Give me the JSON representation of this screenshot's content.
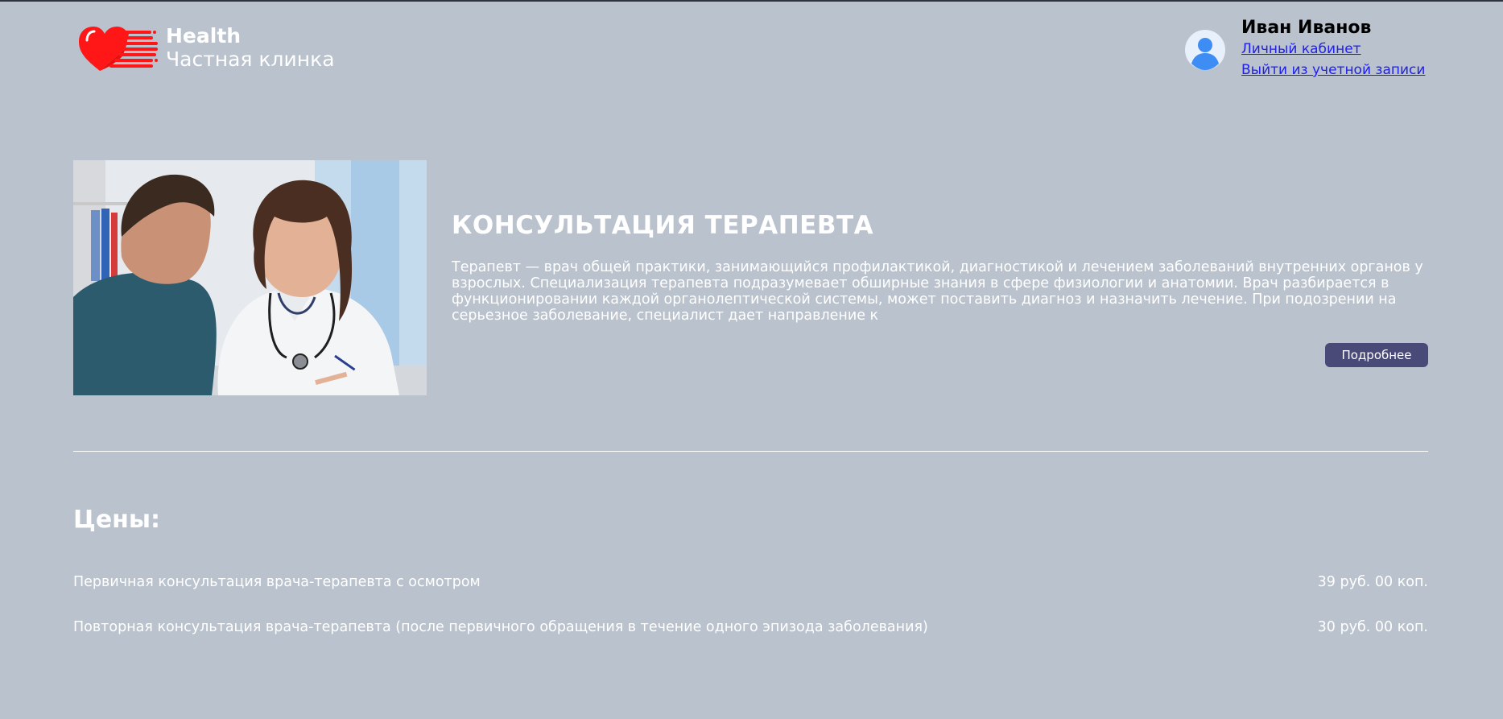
{
  "header": {
    "logo": {
      "title": "Health",
      "subtitle": "Частная клинка",
      "icon": "heart-speed-icon",
      "color": "#ff1a1a"
    },
    "user": {
      "name": "Иван Иванов",
      "profile_link": "Личный кабинет",
      "logout_link": "Выйти из учетной записи",
      "avatar_icon": "user-avatar-icon"
    }
  },
  "service": {
    "title": "КОНСУЛЬТАЦИЯ ТЕРАПЕВТА",
    "description": "Терапевт — врач общей практики, занимающийся профилактикой, диагностикой и лечением заболеваний внутренних органов у взрослых. Специализация терапевта подразумевает обширные знания в сфере физиологии и анатомии. Врач разбирается в функционировании каждой органолептической системы, может поставить диагноз и назначить лечение. При подозрении на серьезное заболевание, специалист дает направление к",
    "more_button": "Подробнее",
    "image": "doctor-consultation-photo"
  },
  "prices": {
    "title": "Цены:",
    "items": [
      {
        "name": "Первичная консультация врача-терапевта с осмотром",
        "price": "39 руб. 00 коп."
      },
      {
        "name": "Повторная консультация врача-терапевта (после первичного обращения в течение одного эпизода заболевания)",
        "price": "30 руб. 00 коп."
      }
    ]
  },
  "colors": {
    "page_background": "#bac2cd",
    "button": "#4a4a78",
    "link": "#2020ee",
    "text": "#ffffff"
  }
}
